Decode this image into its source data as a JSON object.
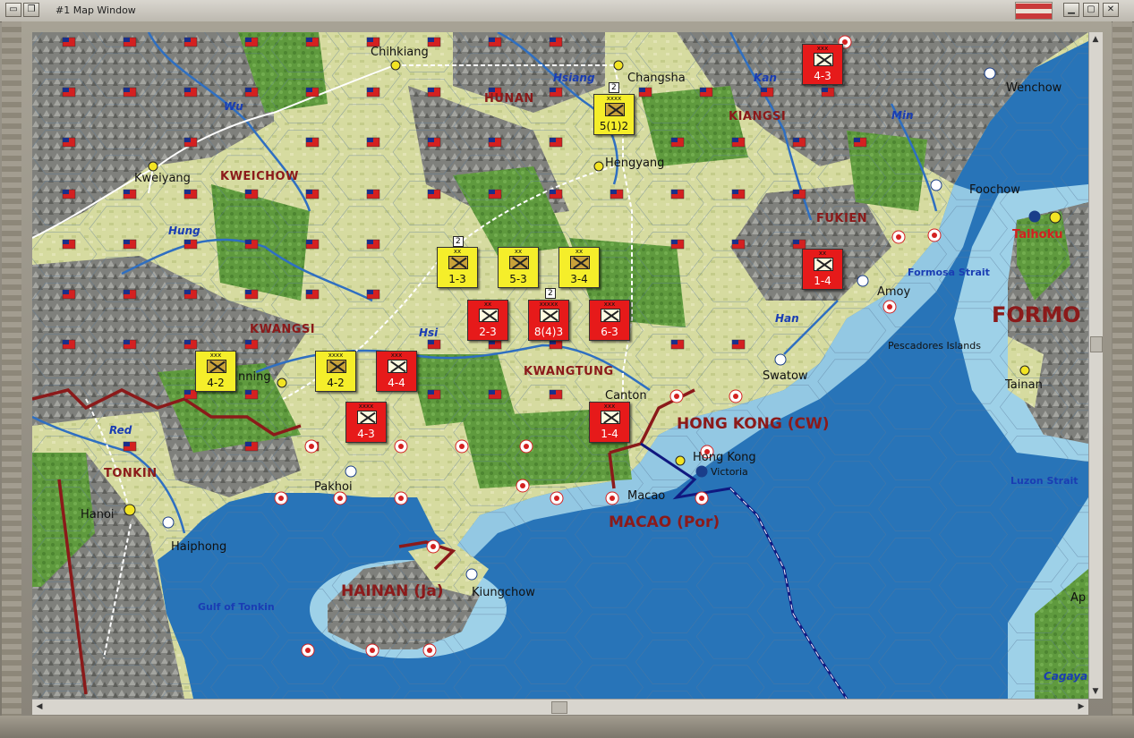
{
  "window": {
    "title": "#1 Map Window",
    "buttons": [
      "sys-menu",
      "minimize",
      "maximize",
      "close"
    ]
  },
  "map": {
    "provinces": [
      "HUNAN",
      "KIANGSI",
      "KWEICHOW",
      "FUKIEN",
      "KWANGSI",
      "KWANGTUNG",
      "TONKIN"
    ],
    "regions": [
      "HONG KONG (CW)",
      "MACAO (Por)",
      "HAINAN (Ja)",
      "FORMO"
    ],
    "cities": [
      "Chihkiang",
      "Changsha",
      "Wenchow",
      "Kweiyang",
      "Hengyang",
      "Foochow",
      "Taihoku",
      "Amoy",
      "Swatow",
      "Tainan",
      "Canton",
      "Hong Kong",
      "Victoria",
      "Macao",
      "Pakhoi",
      "Hanoi",
      "Haiphong",
      "Kiungchow",
      "Pescadores Islands",
      "nning",
      "Ap",
      "Cagaya"
    ],
    "rivers": [
      "Wu",
      "Hsiang",
      "Kan",
      "Min",
      "Hung",
      "Hsi",
      "Han",
      "Red"
    ],
    "seas": [
      "Formosa Strait",
      "Luzon Strait",
      "Gulf of Tonkin"
    ],
    "counters": [
      {
        "id": "c1",
        "side": "allied",
        "size": "xxxx",
        "value": "5(1)2"
      },
      {
        "id": "c2",
        "side": "allied",
        "size": "xx",
        "value": "1-3"
      },
      {
        "id": "c3",
        "side": "allied",
        "size": "xx",
        "value": "5-3"
      },
      {
        "id": "c4",
        "side": "allied",
        "size": "xx",
        "value": "3-4"
      },
      {
        "id": "c5",
        "side": "axis",
        "size": "xx",
        "value": "2-3"
      },
      {
        "id": "c6",
        "side": "axis",
        "size": "xxxxx",
        "value": "8(4)3"
      },
      {
        "id": "c7",
        "side": "axis",
        "size": "xxx",
        "value": "6-3"
      },
      {
        "id": "c8",
        "side": "allied",
        "size": "xxx",
        "value": "4-2"
      },
      {
        "id": "c9",
        "side": "allied",
        "size": "xxxx",
        "value": "4-2"
      },
      {
        "id": "c10",
        "side": "axis",
        "size": "xxx",
        "value": "4-4"
      },
      {
        "id": "c11",
        "side": "axis",
        "size": "xxxx",
        "value": "4-3"
      },
      {
        "id": "c12",
        "side": "axis",
        "size": "xxx",
        "value": "1-4"
      },
      {
        "id": "c13",
        "side": "axis",
        "size": "xx",
        "value": "1-4"
      },
      {
        "id": "c14",
        "side": "axis",
        "size": "xxx",
        "value": "4-3"
      }
    ],
    "stack_numbers": [
      "2",
      "2",
      "2"
    ],
    "colors": {
      "sea": "#2874b8",
      "coast": "#9ed1e8",
      "lowland": "#d8dc9c",
      "forest": "#5f9a3e",
      "mountain": "#8a8a86",
      "border": "#8b1a1a",
      "allied": "#f5ee2a",
      "axis": "#e61a1a"
    }
  },
  "scrollbars": {
    "left": "◀",
    "right": "▶",
    "up": "▲",
    "down": "▼"
  }
}
